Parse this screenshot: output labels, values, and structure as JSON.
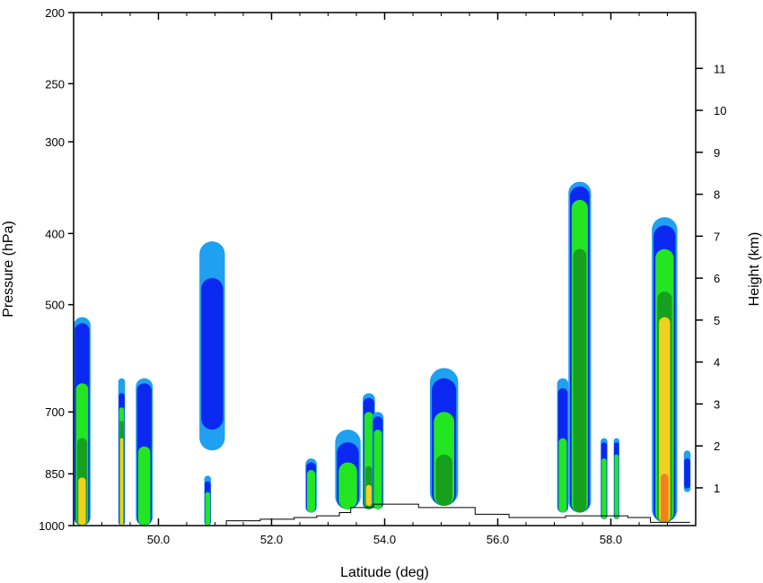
{
  "chart_data": {
    "type": "heatmap",
    "title": "",
    "xlabel": "Latitude (deg)",
    "ylabel_left": "Pressure (hPa)",
    "ylabel_right": "Height (km)",
    "xlim": [
      48.5,
      59.5
    ],
    "ylim_pressure": [
      1000,
      200
    ],
    "y_scale": "log",
    "x_ticks": [
      {
        "value": 50,
        "label": "50.0"
      },
      {
        "value": 52,
        "label": "52.0"
      },
      {
        "value": 54,
        "label": "54.0"
      },
      {
        "value": 56,
        "label": "56.0"
      },
      {
        "value": 58,
        "label": "58.0"
      }
    ],
    "y_ticks_left": [
      {
        "value": 200,
        "label": "200"
      },
      {
        "value": 250,
        "label": "250"
      },
      {
        "value": 300,
        "label": "300"
      },
      {
        "value": 400,
        "label": "400"
      },
      {
        "value": 500,
        "label": "500"
      },
      {
        "value": 700,
        "label": "700"
      },
      {
        "value": 850,
        "label": "850"
      },
      {
        "value": 1000,
        "label": "1000"
      }
    ],
    "y_ticks_right": [
      {
        "value": 1,
        "label": "1"
      },
      {
        "value": 2,
        "label": "2"
      },
      {
        "value": 3,
        "label": "3"
      },
      {
        "value": 4,
        "label": "4"
      },
      {
        "value": 5,
        "label": "5"
      },
      {
        "value": 6,
        "label": "6"
      },
      {
        "value": 7,
        "label": "7"
      },
      {
        "value": 8,
        "label": "8"
      },
      {
        "value": 9,
        "label": "9"
      },
      {
        "value": 10,
        "label": "10"
      },
      {
        "value": 11,
        "label": "11"
      }
    ],
    "contour_colors": [
      "#1fa0f0",
      "#0a28f0",
      "#22e622",
      "#16a01e",
      "#f0d21e",
      "#f0821e"
    ],
    "cells": [
      {
        "lat": 48.65,
        "width": 0.3,
        "top": 520,
        "levels": [
          {
            "top": 520,
            "bottom": 1000
          },
          {
            "top": 530,
            "bottom": 1000
          },
          {
            "top": 640,
            "bottom": 1000
          },
          {
            "top": 760,
            "bottom": 1000
          },
          {
            "top": 860,
            "bottom": 1000
          }
        ]
      },
      {
        "lat": 49.35,
        "width": 0.12,
        "top": 630,
        "levels": [
          {
            "top": 630,
            "bottom": 1000
          },
          {
            "top": 660,
            "bottom": 1000
          },
          {
            "top": 690,
            "bottom": 1000
          },
          {
            "top": 720,
            "bottom": 1000
          },
          {
            "top": 760,
            "bottom": 1000
          }
        ]
      },
      {
        "lat": 49.75,
        "width": 0.3,
        "top": 630,
        "levels": [
          {
            "top": 630,
            "bottom": 1000
          },
          {
            "top": 640,
            "bottom": 1000
          },
          {
            "top": 780,
            "bottom": 1000
          }
        ]
      },
      {
        "lat": 50.95,
        "width": 0.45,
        "top": 410,
        "levels": [
          {
            "top": 410,
            "bottom": 790
          },
          {
            "top": 460,
            "bottom": 740
          }
        ]
      },
      {
        "lat": 50.87,
        "width": 0.12,
        "top": 855,
        "levels": [
          {
            "top": 855,
            "bottom": 1000
          },
          {
            "top": 870,
            "bottom": 1000
          },
          {
            "top": 900,
            "bottom": 1000
          }
        ]
      },
      {
        "lat": 52.7,
        "width": 0.2,
        "top": 810,
        "levels": [
          {
            "top": 810,
            "bottom": 960
          },
          {
            "top": 820,
            "bottom": 960
          },
          {
            "top": 840,
            "bottom": 960
          }
        ]
      },
      {
        "lat": 53.35,
        "width": 0.45,
        "top": 740,
        "levels": [
          {
            "top": 740,
            "bottom": 950
          },
          {
            "top": 770,
            "bottom": 950
          },
          {
            "top": 820,
            "bottom": 950
          }
        ]
      },
      {
        "lat": 53.72,
        "width": 0.22,
        "top": 660,
        "levels": [
          {
            "top": 660,
            "bottom": 950
          },
          {
            "top": 670,
            "bottom": 950
          },
          {
            "top": 700,
            "bottom": 950
          },
          {
            "top": 830,
            "bottom": 950
          },
          {
            "top": 880,
            "bottom": 940
          }
        ]
      },
      {
        "lat": 53.88,
        "width": 0.2,
        "top": 700,
        "levels": [
          {
            "top": 700,
            "bottom": 950
          },
          {
            "top": 710,
            "bottom": 950
          },
          {
            "top": 740,
            "bottom": 950
          }
        ]
      },
      {
        "lat": 55.05,
        "width": 0.5,
        "top": 610,
        "levels": [
          {
            "top": 610,
            "bottom": 940
          },
          {
            "top": 630,
            "bottom": 940
          },
          {
            "top": 700,
            "bottom": 940
          },
          {
            "top": 800,
            "bottom": 940
          }
        ]
      },
      {
        "lat": 57.15,
        "width": 0.2,
        "top": 630,
        "levels": [
          {
            "top": 630,
            "bottom": 960
          },
          {
            "top": 650,
            "bottom": 960
          },
          {
            "top": 760,
            "bottom": 960
          }
        ]
      },
      {
        "lat": 57.45,
        "width": 0.4,
        "top": 340,
        "levels": [
          {
            "top": 340,
            "bottom": 960
          },
          {
            "top": 345,
            "bottom": 960
          },
          {
            "top": 360,
            "bottom": 960
          },
          {
            "top": 420,
            "bottom": 960
          }
        ]
      },
      {
        "lat": 57.88,
        "width": 0.12,
        "top": 760,
        "levels": [
          {
            "top": 760,
            "bottom": 980
          },
          {
            "top": 770,
            "bottom": 980
          },
          {
            "top": 810,
            "bottom": 980
          }
        ]
      },
      {
        "lat": 58.1,
        "width": 0.1,
        "top": 760,
        "levels": [
          {
            "top": 760,
            "bottom": 980
          },
          {
            "top": 770,
            "bottom": 980
          },
          {
            "top": 800,
            "bottom": 980
          }
        ]
      },
      {
        "lat": 58.95,
        "width": 0.45,
        "top": 380,
        "levels": [
          {
            "top": 380,
            "bottom": 990
          },
          {
            "top": 390,
            "bottom": 990
          },
          {
            "top": 420,
            "bottom": 990
          },
          {
            "top": 480,
            "bottom": 990
          },
          {
            "top": 520,
            "bottom": 990
          },
          {
            "top": 850,
            "bottom": 990
          }
        ]
      },
      {
        "lat": 59.35,
        "width": 0.12,
        "top": 790,
        "levels": [
          {
            "top": 790,
            "bottom": 900
          },
          {
            "top": 810,
            "bottom": 890
          }
        ]
      }
    ]
  }
}
